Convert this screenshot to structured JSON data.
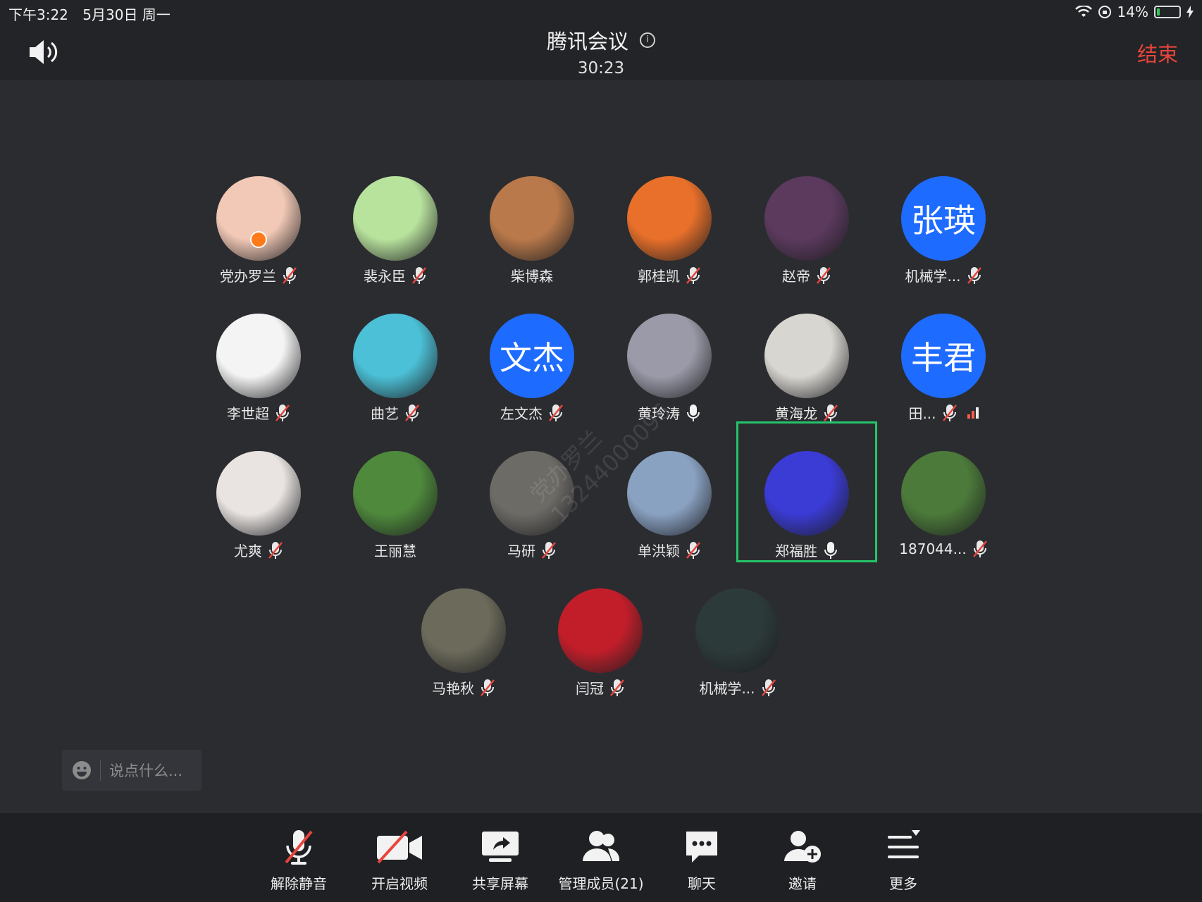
{
  "status_bar": {
    "time": "下午3:22",
    "date": "5月30日 周一",
    "battery_percent": "14%",
    "battery_level": 0.14
  },
  "header": {
    "title": "腾讯会议",
    "timer": "30:23",
    "end_label": "结束"
  },
  "participants": [
    {
      "name": "党办罗兰",
      "avatar": "photo",
      "mic": "muted",
      "host": true,
      "color": "#f2c9b6"
    },
    {
      "name": "裴永臣",
      "avatar": "photo",
      "mic": "muted",
      "color": "#b8e39d"
    },
    {
      "name": "柴博森",
      "avatar": "photo",
      "mic": "none",
      "color": "#b9794a"
    },
    {
      "name": "郭桂凯",
      "avatar": "photo",
      "mic": "muted",
      "color": "#e8702a"
    },
    {
      "name": "赵帝",
      "avatar": "photo",
      "mic": "muted",
      "color": "#5c3a5e"
    },
    {
      "name": "机械学...",
      "avatar_text": "张瑛",
      "avatar": "text",
      "mic": "muted"
    },
    {
      "name": "李世超",
      "avatar": "photo",
      "mic": "muted",
      "color": "#f4f4f4"
    },
    {
      "name": "曲艺",
      "avatar": "photo",
      "mic": "muted",
      "color": "#4cc0d6"
    },
    {
      "name": "左文杰",
      "avatar_text": "文杰",
      "avatar": "text",
      "mic": "muted"
    },
    {
      "name": "黄玲涛",
      "avatar": "photo",
      "mic": "on",
      "color": "#9a9aa8"
    },
    {
      "name": "黄海龙",
      "avatar": "photo",
      "mic": "muted",
      "color": "#d8d6d0"
    },
    {
      "name": "田...",
      "avatar_text": "丰君",
      "avatar": "text",
      "mic": "muted",
      "signal": true
    },
    {
      "name": "尤爽",
      "avatar": "photo",
      "mic": "muted",
      "color": "#e9e4e1"
    },
    {
      "name": "王丽慧",
      "avatar": "photo",
      "mic": "none",
      "color": "#4f8a3c"
    },
    {
      "name": "马研",
      "avatar": "photo",
      "mic": "muted",
      "color": "#6d6b66"
    },
    {
      "name": "单洪颖",
      "avatar": "photo",
      "mic": "muted",
      "color": "#8aa2c2"
    },
    {
      "name": "郑福胜",
      "avatar": "photo",
      "mic": "on",
      "speaking": true,
      "color": "#3b3bd6"
    },
    {
      "name": "187044...",
      "avatar": "photo",
      "mic": "muted",
      "color": "#4c7a3a"
    },
    {
      "name": "马艳秋",
      "avatar": "photo",
      "mic": "muted",
      "color": "#6c6a5a"
    },
    {
      "name": "闫冠",
      "avatar": "photo",
      "mic": "muted",
      "color": "#c21e2a"
    },
    {
      "name": "机械学...",
      "avatar": "photo",
      "mic": "muted",
      "color": "#2d3a3a"
    }
  ],
  "chat": {
    "placeholder": "说点什么..."
  },
  "watermark": {
    "line1": "党办罗兰",
    "line2": "13244000096"
  },
  "toolbar": {
    "items": [
      {
        "label": "解除静音",
        "icon": "mic-muted-icon"
      },
      {
        "label": "开启视频",
        "icon": "video-off-icon"
      },
      {
        "label": "共享屏幕",
        "icon": "share-screen-icon"
      },
      {
        "label": "管理成员(21)",
        "icon": "members-icon"
      },
      {
        "label": "聊天",
        "icon": "chat-icon"
      },
      {
        "label": "邀请",
        "icon": "invite-icon"
      },
      {
        "label": "更多",
        "icon": "more-icon"
      }
    ]
  }
}
